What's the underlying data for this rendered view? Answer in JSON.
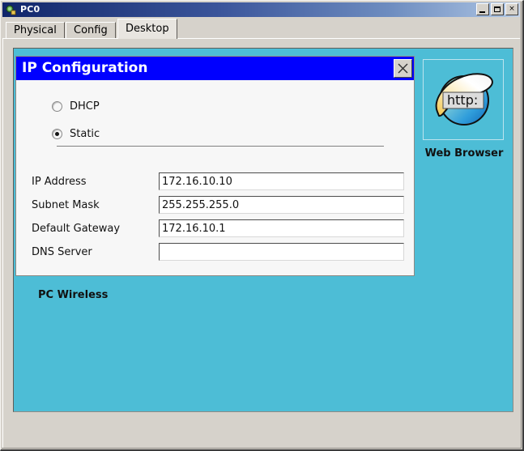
{
  "window": {
    "title": "PC0",
    "icon": "pc-device-icon",
    "controls": {
      "minimize": "minimize-button",
      "maximize": "maximize-button",
      "close": "close-button",
      "close_glyph": "×"
    }
  },
  "tabs": [
    {
      "label": "Physical",
      "active": false
    },
    {
      "label": "Config",
      "active": false
    },
    {
      "label": "Desktop",
      "active": true
    }
  ],
  "desktop": {
    "background_color": "#4dbdd6",
    "pc_wireless_label": "PC Wireless",
    "browser_shortcut": {
      "label": "Web Browser",
      "icon": "globe-browser-icon",
      "icon_text": "http:"
    }
  },
  "ip_configuration": {
    "title": "IP Configuration",
    "title_bar_color": "#0000ff",
    "close_button_label": "×",
    "mode_options": [
      {
        "label": "DHCP",
        "selected": false
      },
      {
        "label": "Static",
        "selected": true
      }
    ],
    "fields": [
      {
        "label": "IP Address",
        "value": "172.16.10.10",
        "placeholder": ""
      },
      {
        "label": "Subnet Mask",
        "value": "255.255.255.0",
        "placeholder": ""
      },
      {
        "label": "Default Gateway",
        "value": "172.16.10.1",
        "placeholder": ""
      },
      {
        "label": "DNS Server",
        "value": "",
        "placeholder": ""
      }
    ]
  }
}
